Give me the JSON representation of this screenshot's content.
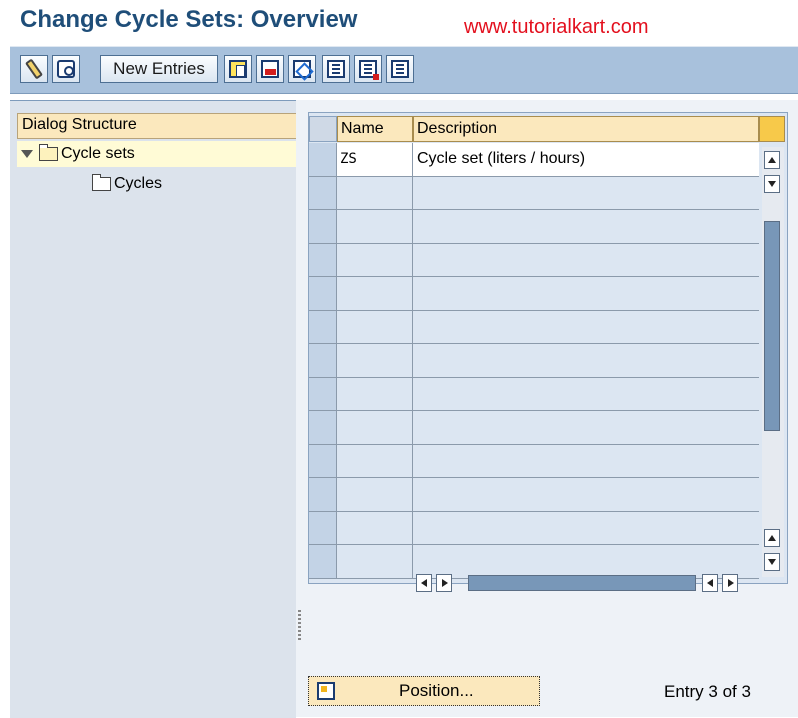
{
  "header": {
    "title": "Change Cycle Sets: Overview",
    "watermark": "www.tutorialkart.com"
  },
  "toolbar": {
    "buttons": [
      {
        "icon": "pencil-icon"
      },
      {
        "icon": "display-glasses-icon"
      },
      {
        "label": "New Entries"
      },
      {
        "icon": "copy-icon"
      },
      {
        "icon": "delete-icon"
      },
      {
        "icon": "undo-icon"
      },
      {
        "icon": "select-all-icon"
      },
      {
        "icon": "select-block-icon"
      },
      {
        "icon": "deselect-all-icon"
      }
    ]
  },
  "dialog_structure": {
    "header": "Dialog Structure",
    "items": [
      {
        "label": "Cycle sets",
        "expanded": true,
        "selected": true
      },
      {
        "label": "Cycles",
        "expanded": false,
        "selected": false
      }
    ]
  },
  "table": {
    "columns": [
      "Name",
      "Description"
    ],
    "rows": [
      {
        "name": "ZS",
        "description": "Cycle set (liters / hours)"
      },
      {
        "name": "",
        "description": ""
      },
      {
        "name": "",
        "description": ""
      },
      {
        "name": "",
        "description": ""
      },
      {
        "name": "",
        "description": ""
      },
      {
        "name": "",
        "description": ""
      },
      {
        "name": "",
        "description": ""
      },
      {
        "name": "",
        "description": ""
      },
      {
        "name": "",
        "description": ""
      },
      {
        "name": "",
        "description": ""
      },
      {
        "name": "",
        "description": ""
      },
      {
        "name": "",
        "description": ""
      },
      {
        "name": "",
        "description": ""
      }
    ]
  },
  "footer": {
    "position_label": "Position...",
    "entry_status": "Entry 3 of 3"
  },
  "colors": {
    "title": "#1f4e79",
    "watermark": "#e3101e",
    "toolbar_bg": "#a8c1dc",
    "header_bg": "#fbe8bd"
  }
}
